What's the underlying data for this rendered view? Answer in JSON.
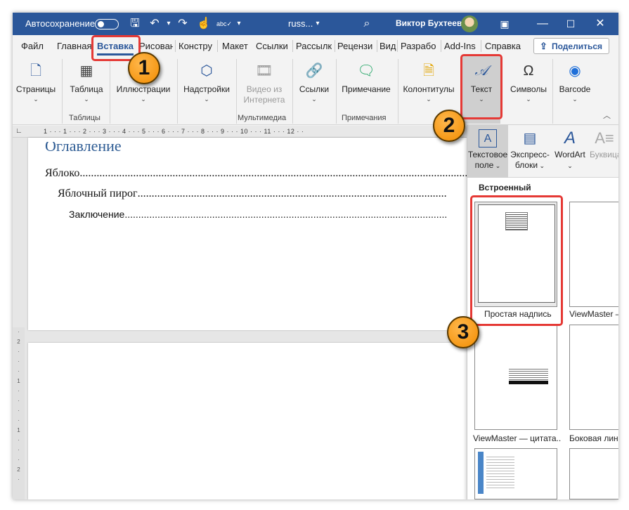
{
  "titlebar": {
    "autosave_label": "Автосохранение",
    "doc_name": "russ...",
    "user_name": "Виктор Бухтеев",
    "icons": [
      "save-icon",
      "undo-icon",
      "redo-icon",
      "touch-mode-icon",
      "spellcheck-icon",
      "chevron-down-icon",
      "search-icon",
      "ribbon-display-icon",
      "minimize-icon",
      "maximize-icon",
      "close-icon"
    ]
  },
  "tabs": [
    "Файл",
    "Главная",
    "Вставка",
    "Рисован",
    "Констру",
    "Макет",
    "Ссылки",
    "Рассылк",
    "Рецензи",
    "Вид",
    "Разрабо",
    "Add-Ins",
    "Справка"
  ],
  "active_tab": "Вставка",
  "share_label": "Поделиться",
  "ribbon": {
    "buttons": [
      {
        "label": "Страницы",
        "icon": "pages-icon"
      },
      {
        "label": "Таблица",
        "icon": "table-icon"
      },
      {
        "label": "Иллюстрации",
        "icon": "illustrations-icon"
      },
      {
        "label": "Надстройки",
        "icon": "addins-icon"
      },
      {
        "label": "Видео из",
        "label2": "Интернета",
        "icon": "online-video-icon"
      },
      {
        "label": "Ссылки",
        "icon": "link-icon"
      },
      {
        "label": "Примечание",
        "icon": "comment-icon"
      },
      {
        "label": "Колонтитулы",
        "icon": "header-footer-icon"
      },
      {
        "label": "Текст",
        "icon": "text-icon"
      },
      {
        "label": "Символы",
        "icon": "symbols-icon"
      },
      {
        "label": "Barcode",
        "icon": "barcode-icon"
      }
    ],
    "groups": [
      "Таблицы",
      "Мультимедиа",
      "Примечания"
    ]
  },
  "ruler_numbers": "1 · · · 1 · · · 2 · · · 3 · · · 4 · · · 5 · · · 6 · · · 7 · · · 8 · · · 9 · · · 10 · · · 11 · · · 12 · ·",
  "document": {
    "toc_heading": "Оглавление",
    "entries": [
      {
        "text": "Яблоко"
      },
      {
        "text": "Яблочный пирог"
      },
      {
        "text": "Заключение"
      }
    ]
  },
  "dropdown": {
    "buttons": [
      {
        "label": "Текстовое",
        "label2": "поле",
        "icon": "textbox-icon"
      },
      {
        "label": "Экспресс-",
        "label2": "блоки",
        "icon": "quick-parts-icon"
      },
      {
        "label": "WordArt",
        "label2": "",
        "icon": "wordart-icon"
      },
      {
        "label": "Буквица",
        "label2": "",
        "icon": "dropcap-icon"
      }
    ],
    "section_title": "Встроенный",
    "gallery": [
      {
        "caption": "Простая надпись"
      },
      {
        "caption": "ViewMaster —"
      },
      {
        "caption": "ViewMaster — цитата..."
      },
      {
        "caption": "Боковая лини"
      },
      {
        "caption": ""
      },
      {
        "caption": ""
      }
    ]
  },
  "annotations": [
    "1",
    "2",
    "3"
  ]
}
